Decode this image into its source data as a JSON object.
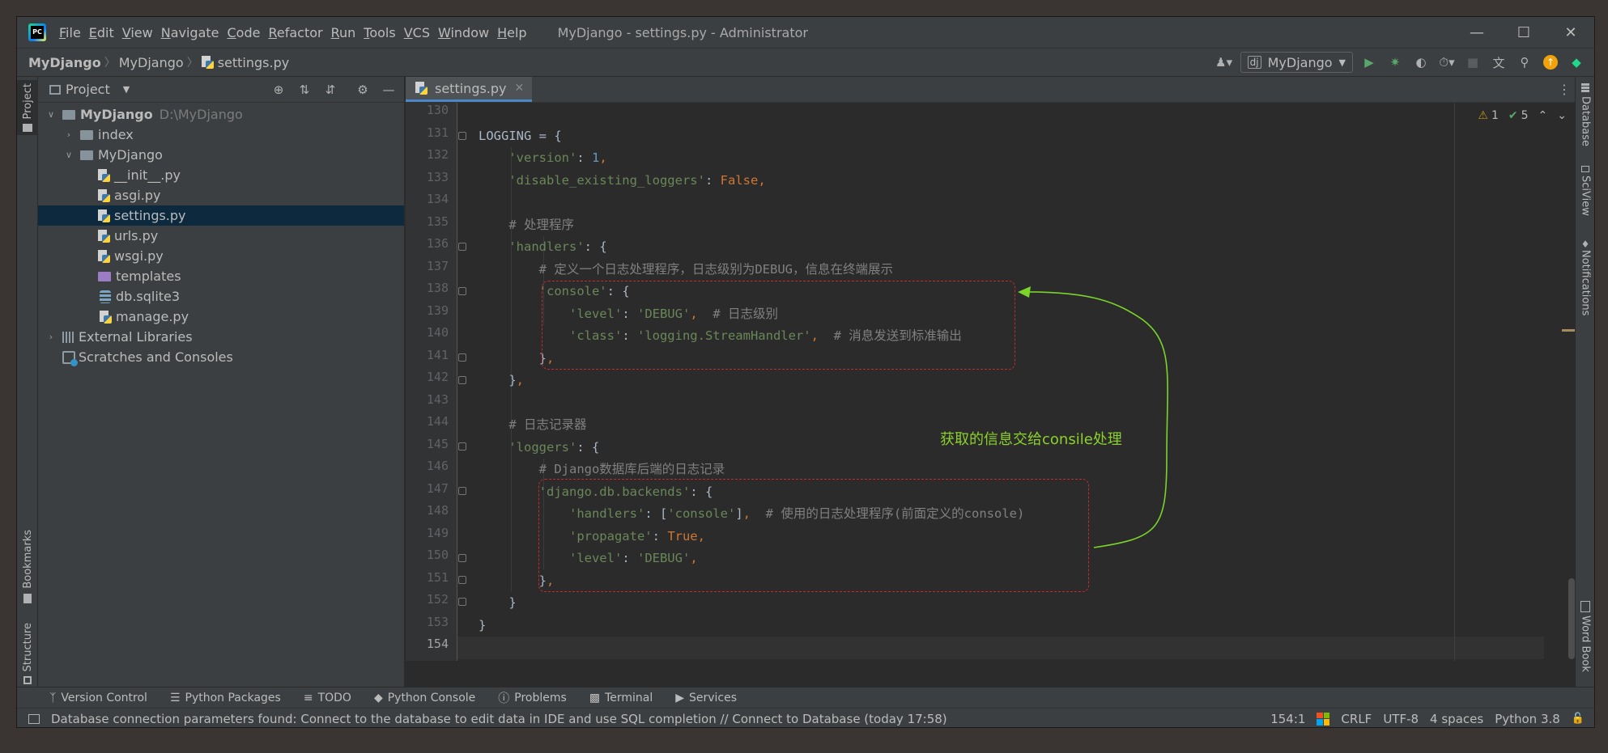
{
  "app": {
    "title": "MyDjango - settings.py - Administrator",
    "menu": [
      "File",
      "Edit",
      "View",
      "Navigate",
      "Code",
      "Refactor",
      "Run",
      "Tools",
      "VCS",
      "Window",
      "Help"
    ]
  },
  "breadcrumb": [
    "MyDjango",
    "MyDjango",
    "settings.py"
  ],
  "toolbar": {
    "run_config": "MyDjango"
  },
  "left_strip": {
    "project": "Project",
    "bookmarks": "Bookmarks",
    "structure": "Structure"
  },
  "right_strip": {
    "database": "Database",
    "sciview": "SciView",
    "notifications": "Notifications",
    "wordbook": "Word Book"
  },
  "project_panel": {
    "title": "Project",
    "tree": [
      {
        "label": "MyDjango",
        "hint": "D:\\MyDjango"
      },
      {
        "label": "index"
      },
      {
        "label": "MyDjango"
      },
      {
        "label": "__init__.py"
      },
      {
        "label": "asgi.py"
      },
      {
        "label": "settings.py"
      },
      {
        "label": "urls.py"
      },
      {
        "label": "wsgi.py"
      },
      {
        "label": "templates"
      },
      {
        "label": "db.sqlite3"
      },
      {
        "label": "manage.py"
      },
      {
        "label": "External Libraries"
      },
      {
        "label": "Scratches and Consoles"
      }
    ]
  },
  "editor": {
    "tab": "settings.py",
    "inspections": {
      "warnings": "1",
      "ok": "5"
    },
    "line_numbers": [
      "130",
      "131",
      "132",
      "133",
      "134",
      "135",
      "136",
      "137",
      "138",
      "139",
      "140",
      "141",
      "142",
      "143",
      "144",
      "145",
      "146",
      "147",
      "148",
      "149",
      "150",
      "151",
      "152",
      "153",
      "154"
    ],
    "annotation": "获取的信息交给consile处理"
  },
  "toolwindows": [
    "Version Control",
    "Python Packages",
    "TODO",
    "Python Console",
    "Problems",
    "Terminal",
    "Services"
  ],
  "status": {
    "message": "Database connection parameters found: Connect to the database to edit data in IDE and use SQL completion // Connect to Database (today 17:58)",
    "position": "154:1",
    "line_sep": "CRLF",
    "encoding": "UTF-8",
    "indent": "4 spaces",
    "interpreter": "Python 3.8"
  }
}
